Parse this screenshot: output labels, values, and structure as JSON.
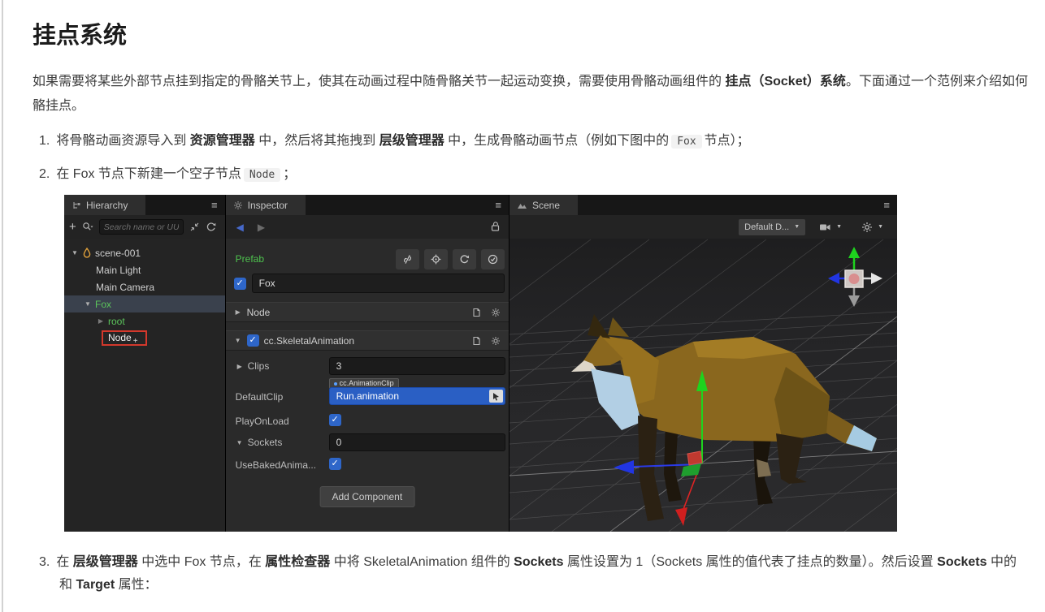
{
  "doc": {
    "title": "挂点系统",
    "para": {
      "a": "如果需要将某些外部节点挂到指定的骨骼关节上，使其在动画过程中随骨骼关节一起运动变换，需要使用骨骼动画组件的 ",
      "b": "挂点（Socket）系统",
      "c": "。下面通过一个范例来介绍如何",
      "line2": "骼挂点。"
    },
    "item1": {
      "num": "1.",
      "a": "将骨骼动画资源导入到 ",
      "b": "资源管理器",
      "c": " 中，然后将其拖拽到 ",
      "d": "层级管理器",
      "e": " 中，生成骨骼动画节点（例如下图中的",
      "code": "Fox",
      "f": "节点）；"
    },
    "item2": {
      "num": "2.",
      "a": "在 Fox 节点下新建一个空子节点",
      "code": "Node",
      "b": "；"
    },
    "item3": {
      "num": "3.",
      "a": "在 ",
      "b": "层级管理器",
      "c": " 中选中 Fox 节点，在 ",
      "d": "属性检查器",
      "e": " 中将 SkeletalAnimation 组件的 ",
      "f": "Sockets",
      "g": " 属性设置为 1（Sockets 属性的值代表了挂点的数量）。然后设置 ",
      "h": "Sockets",
      "i": " 中的",
      "l2a": "和 ",
      "l2b": "Target",
      "l2c": " 属性："
    }
  },
  "editor": {
    "hierarchy": {
      "tab": "Hierarchy",
      "search_placeholder": "Search name or UUID",
      "nodes": {
        "scene": "scene-001",
        "light": "Main Light",
        "camera": "Main Camera",
        "fox": "Fox",
        "root": "root",
        "node": "Node",
        "node_suffix": "+"
      }
    },
    "inspector": {
      "tab": "Inspector",
      "prefab_label": "Prefab",
      "name_value": "Fox",
      "node_section": "Node",
      "anim_section": "cc.SkeletalAnimation",
      "clips_label": "Clips",
      "clips_value": "3",
      "defaultclip_label": "DefaultClip",
      "defaultclip_tag": "cc.AnimationClip",
      "defaultclip_value": "Run.animation",
      "playonload_label": "PlayOnLoad",
      "sockets_label": "Sockets",
      "sockets_value": "0",
      "usebaked_label": "UseBakedAnima...",
      "add_component": "Add Component"
    },
    "scene": {
      "tab": "Scene",
      "view_dropdown": "Default D..."
    }
  },
  "icons": {
    "menu": "≡",
    "plus": "+",
    "caret_down": "▼",
    "caret_right": "▶",
    "check": "✓",
    "back": "◀",
    "forward": "▶",
    "dropdown": "▼"
  },
  "colors": {
    "accent_blue": "#2e66c9",
    "prefab_green": "#4ec34e",
    "node_green": "#5bc45b",
    "annotation_red": "#d3382c",
    "gizmo_green": "#1ed31e",
    "gizmo_blue": "#2135e2",
    "gizmo_red": "#d42a2a"
  }
}
